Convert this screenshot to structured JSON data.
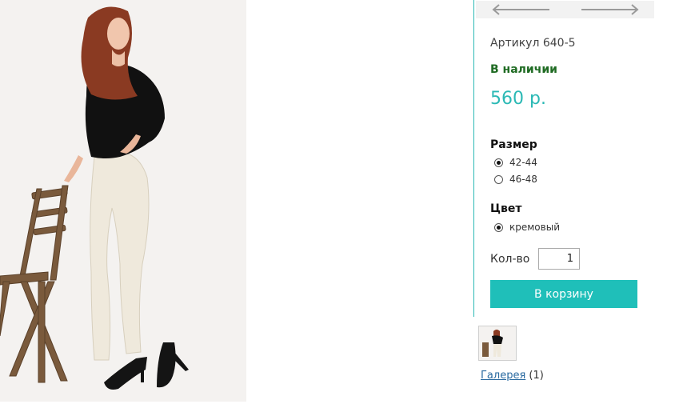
{
  "product": {
    "photo_icon": "product-photo",
    "sku": "Артикул 640-5",
    "stock": "В наличии",
    "price": "560 р."
  },
  "navigation": {
    "prev_icon": "arrow-left-icon",
    "next_icon": "arrow-right-icon"
  },
  "options": {
    "size": {
      "title": "Размер",
      "items": [
        {
          "label": "42-44",
          "checked": true
        },
        {
          "label": "46-48",
          "checked": false
        }
      ]
    },
    "color": {
      "title": "Цвет",
      "items": [
        {
          "label": "кремовый",
          "checked": true
        }
      ]
    }
  },
  "quantity": {
    "label": "Кол-во",
    "value": "1"
  },
  "cart": {
    "button_label": "В корзину"
  },
  "gallery": {
    "link_label": "Галерея",
    "count": "(1)"
  },
  "colors": {
    "accent": "#2bb9b5",
    "button": "#1fbfb9",
    "stock": "#1f6b23",
    "link": "#2a6aa0"
  }
}
